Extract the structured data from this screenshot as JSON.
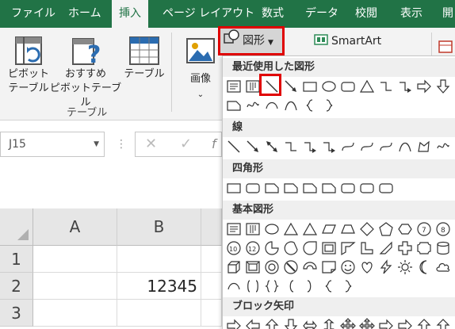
{
  "tabs": [
    "ファイル",
    "ホーム",
    "挿入",
    "ページ レイアウト",
    "数式",
    "データ",
    "校閲",
    "表示",
    "開"
  ],
  "ribbon": {
    "pivot_label_1": "ピボット",
    "pivot_label_2": "テーブル",
    "recpivot_label_1": "おすすめ",
    "recpivot_label_2": "ピボットテーブル",
    "table_label": "テーブル",
    "group_tables": "テーブル",
    "images_label": "画像",
    "shapes_label": "図形",
    "smartart_label": "SmartArt"
  },
  "namebox": {
    "value": "J15"
  },
  "sheet": {
    "columns": [
      "A",
      "B"
    ],
    "rows": [
      "1",
      "2",
      "3"
    ],
    "b2": "12345"
  },
  "shapes_panel": {
    "categories": [
      "最近使用した図形",
      "線",
      "四角形",
      "基本図形",
      "ブロック矢印"
    ]
  },
  "colors": {
    "accent": "#217346",
    "highlight": "#e00000"
  }
}
